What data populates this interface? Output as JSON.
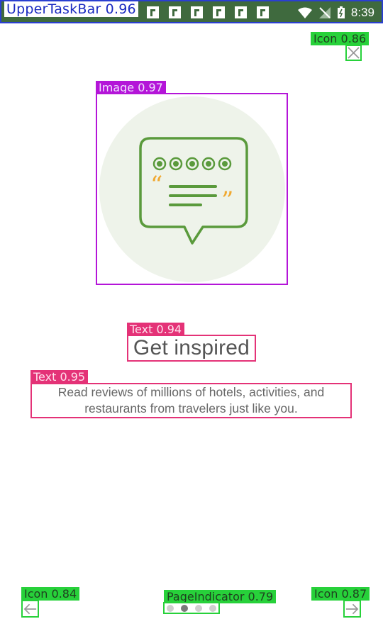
{
  "status_bar": {
    "label": "UpperTaskBar 0.96",
    "time": "8:39",
    "notification_icons": [
      "notification-icon",
      "notification-icon",
      "notification-icon",
      "notification-icon",
      "notification-icon",
      "notification-icon"
    ]
  },
  "annotations": {
    "close_icon": "Icon 0.86",
    "image": "Image 0.97",
    "title": "Text 0.94",
    "description": "Text 0.95",
    "back_icon": "Icon 0.84",
    "page_indicator": "PageIndicator 0.79",
    "next_icon": "Icon 0.87"
  },
  "onboarding": {
    "title": "Get inspired",
    "description_line1": "Read reviews of millions of hotels, activities, and",
    "description_line2": "restaurants from travelers just like you."
  },
  "pager": {
    "count": 4,
    "active_index": 1
  },
  "colors": {
    "accent_green": "#5a9a3c",
    "quote_orange": "#f0a830",
    "circle_bg": "#eef3ea"
  }
}
